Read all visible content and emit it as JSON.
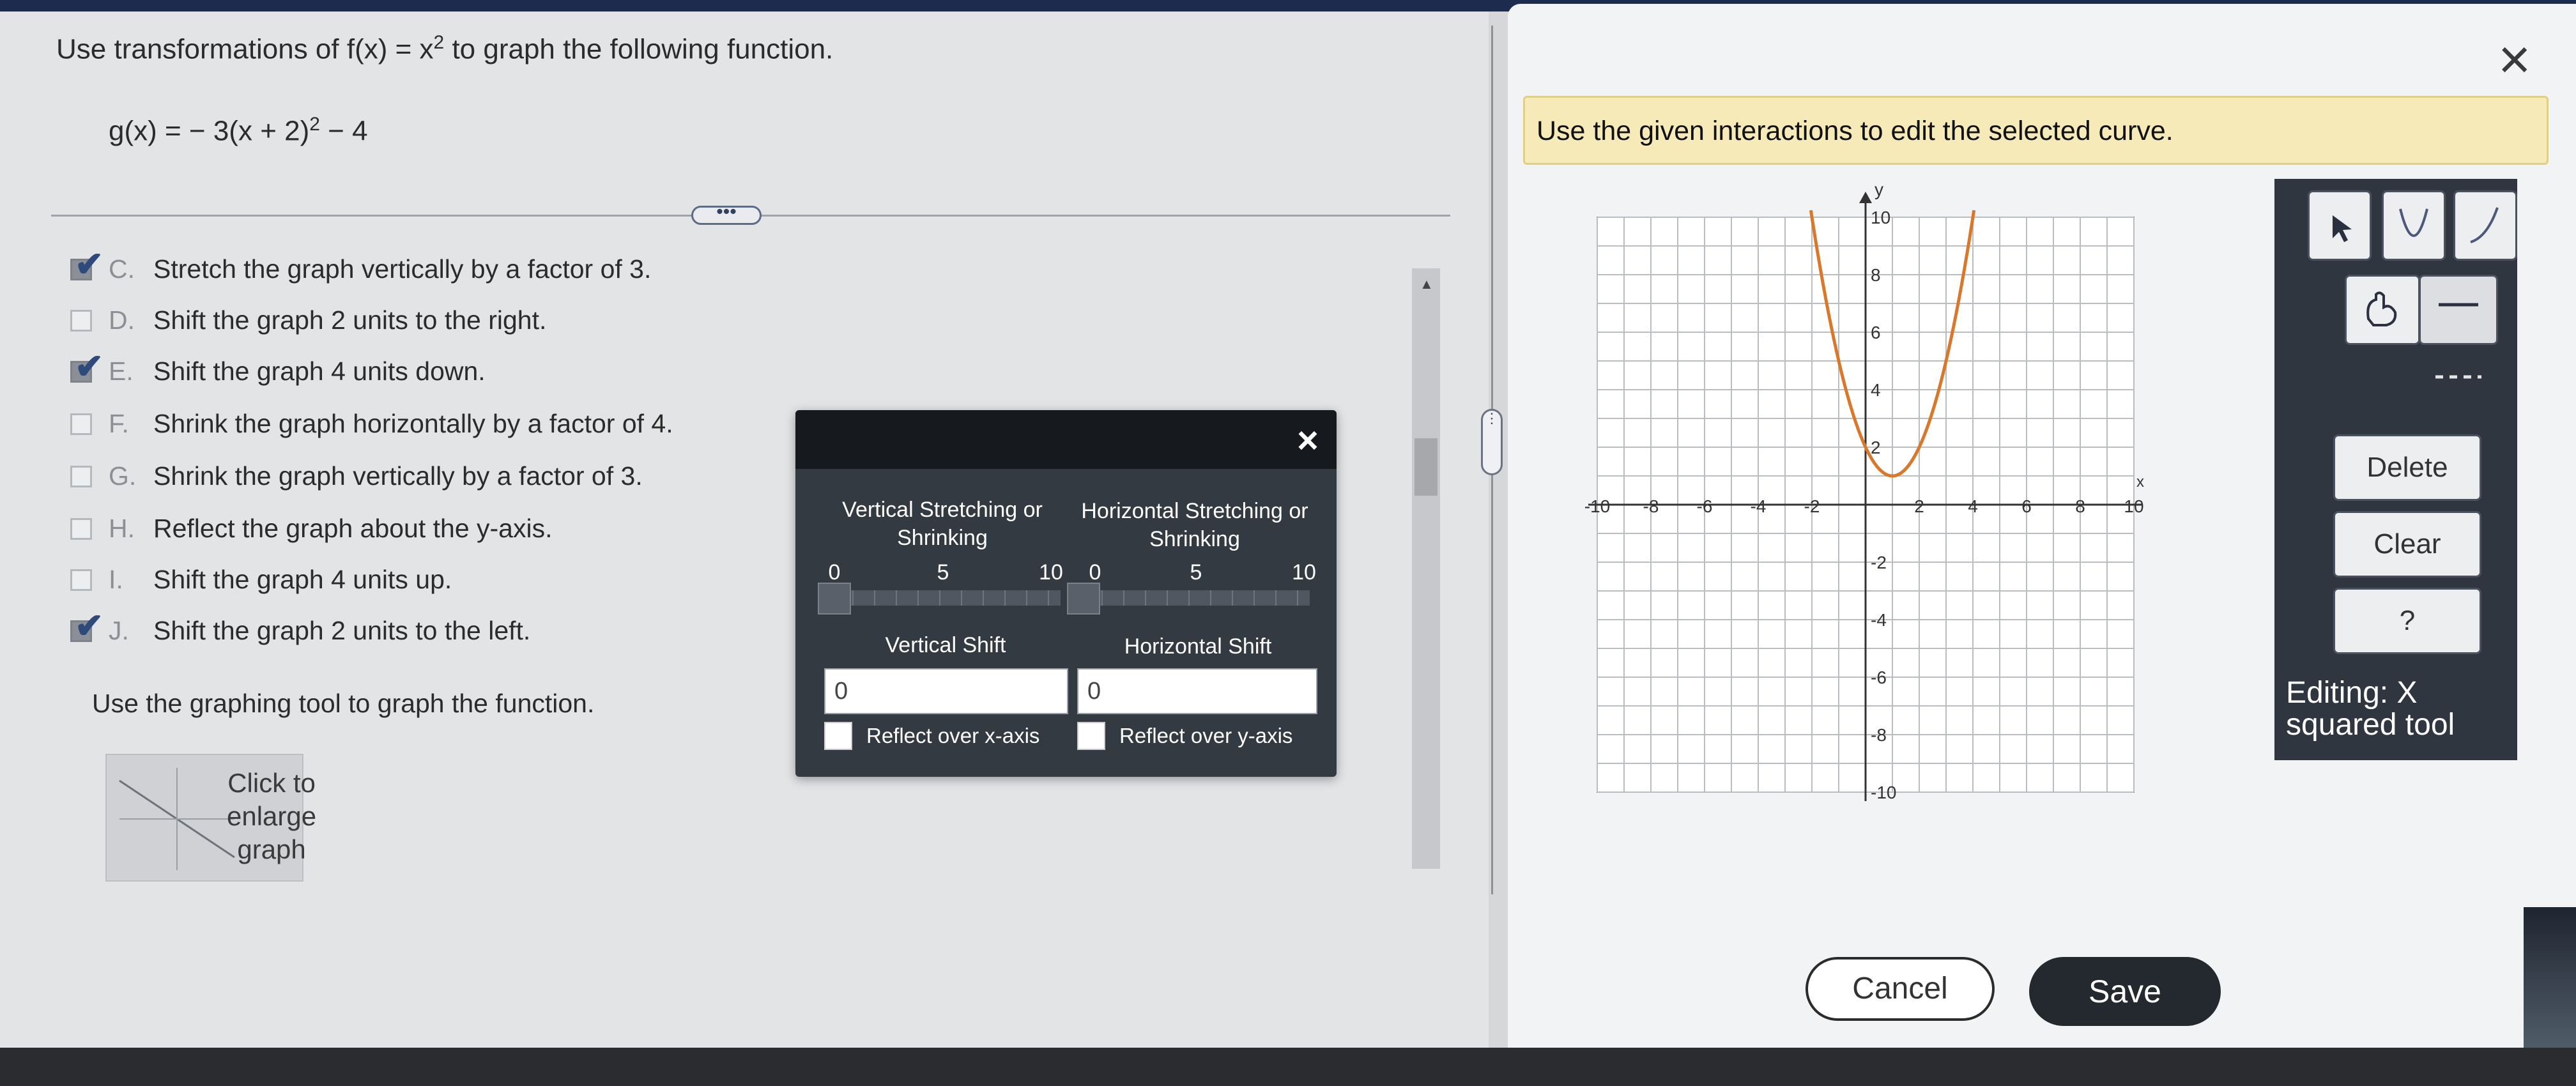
{
  "question": {
    "prompt_prefix": "Use transformations of f(x) = x",
    "prompt_exp": "2",
    "prompt_suffix": " to graph the following function.",
    "function_main": "g(x) = − 3(x + 2)",
    "function_exp": "2",
    "function_tail": " − 4"
  },
  "options": [
    {
      "letter": "C.",
      "text": "Stretch the graph vertically by a factor of 3.",
      "checked": true
    },
    {
      "letter": "D.",
      "text": "Shift the graph 2 units to the right.",
      "checked": false
    },
    {
      "letter": "E.",
      "text": "Shift the graph 4 units down.",
      "checked": true
    },
    {
      "letter": "F.",
      "text": "Shrink the graph horizontally by a factor of 4.",
      "checked": false
    },
    {
      "letter": "G.",
      "text": "Shrink the graph vertically by a factor of 3.",
      "checked": false
    },
    {
      "letter": "H.",
      "text": "Reflect the graph about the y-axis.",
      "checked": false
    },
    {
      "letter": "I.",
      "text": "Shift the graph 4 units up.",
      "checked": false
    },
    {
      "letter": "J.",
      "text": "Shift the graph 2 units to the left.",
      "checked": true
    }
  ],
  "graph_instruction": "Use the graphing tool to graph the function.",
  "enlarge": {
    "line1": "Click to",
    "line2": "enlarge",
    "line3": "graph"
  },
  "dialog": {
    "close_icon": "×",
    "vstretch_title_1": "Vertical Stretching or",
    "vstretch_title_2": "Shrinking",
    "hstretch_title_1": "Horizontal Stretching or",
    "hstretch_title_2": "Shrinking",
    "slider_min": "0",
    "slider_mid": "5",
    "slider_max": "10",
    "vstretch_value": 0,
    "hstretch_value": 0,
    "vshift_label": "Vertical Shift",
    "hshift_label": "Horizontal Shift",
    "vshift_value": "0",
    "hshift_value": "0",
    "reflect_x_label": "Reflect over x-axis",
    "reflect_y_label": "Reflect over y-axis"
  },
  "right_panel": {
    "close_icon": "×",
    "instruction": "Use the given interactions to edit the selected curve.",
    "delete_label": "Delete",
    "clear_label": "Clear",
    "help_label": "?",
    "editing_line1": "Editing: X",
    "editing_line2": "squared tool",
    "cancel_label": "Cancel",
    "save_label": "Save",
    "tools": [
      "pointer-icon",
      "parabola-icon",
      "curve-icon",
      "hand-icon",
      "solid-line-icon",
      "dashed-line-icon"
    ]
  },
  "graph": {
    "x_label": "x",
    "y_label": "y",
    "xlim": [
      -10,
      10
    ],
    "ylim": [
      -10,
      10
    ],
    "x_ticks": [
      "-10",
      "-8",
      "-6",
      "-4",
      "-2",
      "2",
      "4",
      "6",
      "8",
      "10"
    ],
    "y_ticks": [
      "10",
      "8",
      "6",
      "4",
      "2",
      "-2",
      "-4",
      "-6",
      "-8",
      "-10"
    ],
    "curve": {
      "a": 1,
      "h": 1,
      "k": 1,
      "color": "#d9772b"
    }
  }
}
